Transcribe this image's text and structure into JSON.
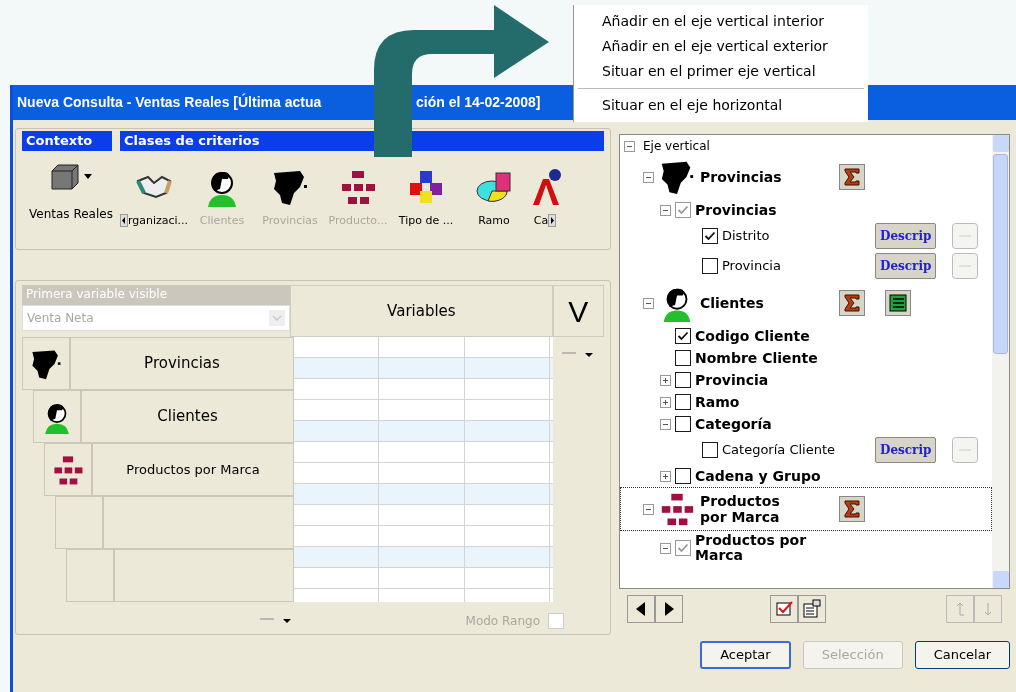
{
  "context_menu": {
    "items": [
      {
        "kind": "item",
        "label": "Añadir en el eje vertical interior"
      },
      {
        "kind": "item",
        "label": "Añadir en el eje vertical exterior"
      },
      {
        "kind": "item",
        "label": "Situar en el primer eje vertical"
      },
      {
        "kind": "separator"
      },
      {
        "kind": "item",
        "label": "Situar en el eje horizontal"
      }
    ]
  },
  "window": {
    "title_parts": [
      "Nueva Consulta - Ventas Reales [Última actua",
      "ción el 14-02-2008]"
    ]
  },
  "headers": {
    "context": "Contexto",
    "criteria": "Clases de criterios"
  },
  "context": {
    "label": "Ventas Reales"
  },
  "criteria": [
    {
      "label": "rganizaci...",
      "disabled": false
    },
    {
      "label": "Clientes",
      "disabled": true
    },
    {
      "label": "Provincias",
      "disabled": true
    },
    {
      "label": "Producto...",
      "disabled": true
    },
    {
      "label": "Tipo de ...",
      "disabled": false
    },
    {
      "label": "Ramo",
      "disabled": false
    },
    {
      "label": "Ca",
      "disabled": false
    }
  ],
  "pivot": {
    "first_visible_label": "Primera variable visible",
    "first_visible_value": "Venta Neta",
    "variables_header": "Variables",
    "sort_glyph": "V",
    "rows": [
      {
        "kind": "criterion",
        "label": "Provincias"
      },
      {
        "kind": "criterion",
        "label": "Clientes"
      },
      {
        "kind": "criterion",
        "label": "Productos por Marca"
      },
      {
        "kind": "empty"
      },
      {
        "kind": "empty"
      }
    ],
    "range_mode": {
      "label": "Modo Rango",
      "checked": false
    }
  },
  "tree": {
    "label": "Eje vertical",
    "expanded": true,
    "children": [
      {
        "kind": "group",
        "label": "Provincias",
        "expanded": true,
        "sum_button": true,
        "children": [
          {
            "kind": "level",
            "label": "Provincias",
            "checked": true,
            "disabled": true,
            "expanded": true,
            "children": [
              {
                "kind": "field",
                "label": "Distrito",
                "checked": true,
                "button": "Descrip"
              },
              {
                "kind": "field",
                "label": "Provincia",
                "checked": false,
                "button": "Descrip"
              }
            ]
          }
        ]
      },
      {
        "kind": "group",
        "label": "Clientes",
        "expanded": true,
        "sum_button": true,
        "list_button": true,
        "children": [
          {
            "kind": "level",
            "label": "Codigo Cliente",
            "checked": true,
            "disabled": false
          },
          {
            "kind": "level",
            "label": "Nombre Cliente",
            "checked": false,
            "disabled": false
          },
          {
            "kind": "level",
            "label": "Provincia",
            "checked": false,
            "disabled": false,
            "expanded": false
          },
          {
            "kind": "level",
            "label": "Ramo",
            "checked": false,
            "disabled": false,
            "expanded": false
          },
          {
            "kind": "level",
            "label": "Categoría",
            "checked": false,
            "disabled": false,
            "expanded": true,
            "children": [
              {
                "kind": "field",
                "label": "Categoría Cliente",
                "checked": false,
                "button": "Descrip"
              }
            ]
          },
          {
            "kind": "level",
            "label": "Cadena y Grupo",
            "checked": false,
            "disabled": false,
            "expanded": false
          }
        ]
      },
      {
        "kind": "group",
        "label": "Productos por Marca",
        "expanded": true,
        "focused": true,
        "sum_button": true,
        "children": [
          {
            "kind": "level",
            "label": "Productos por Marca",
            "checked": true,
            "disabled": true,
            "expanded": true
          }
        ]
      }
    ]
  },
  "buttons": [
    {
      "label": "Aceptar",
      "disabled": false,
      "default": true
    },
    {
      "label": "Selección",
      "disabled": true,
      "default": false
    },
    {
      "label": "Cancelar",
      "disabled": false,
      "default": false
    }
  ]
}
